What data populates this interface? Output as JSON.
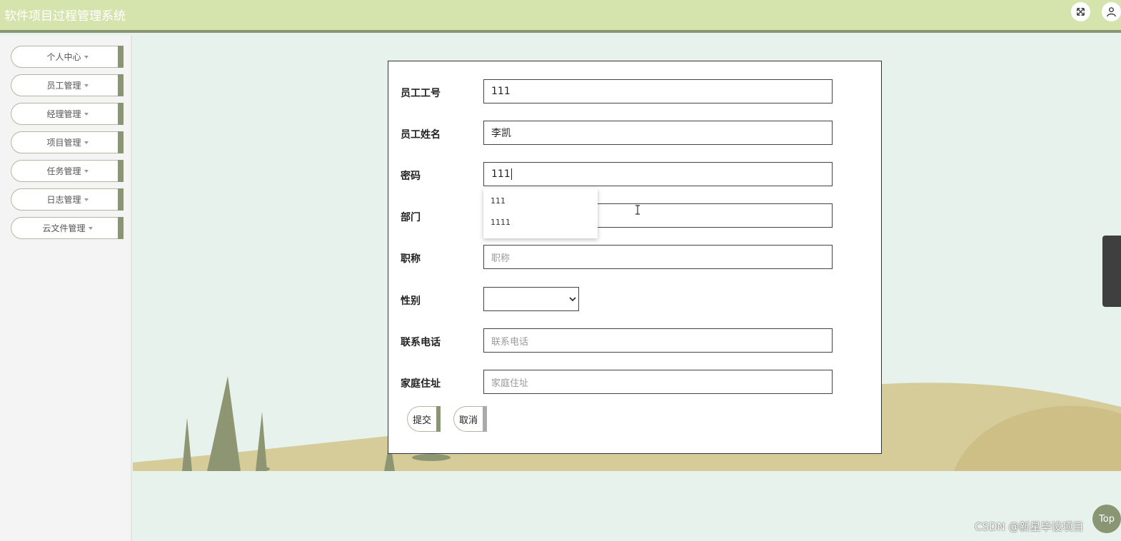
{
  "header": {
    "title": "软件项目过程管理系统",
    "fullscreen_icon": "fullscreen-icon",
    "user_icon": "user-icon",
    "bg_color": "#d5e4ad",
    "accent_color": "#8a9574"
  },
  "sidebar": {
    "items": [
      {
        "label": "个人中心"
      },
      {
        "label": "员工管理"
      },
      {
        "label": "经理管理"
      },
      {
        "label": "项目管理"
      },
      {
        "label": "任务管理"
      },
      {
        "label": "日志管理"
      },
      {
        "label": "云文件管理"
      }
    ]
  },
  "form": {
    "fields": {
      "employee_id": {
        "label": "员工工号",
        "value": "111"
      },
      "employee_name": {
        "label": "员工姓名",
        "value": "李凯"
      },
      "password": {
        "label": "密码",
        "value": "111"
      },
      "department": {
        "label": "部门",
        "value": ""
      },
      "title": {
        "label": "职称",
        "placeholder": "职称"
      },
      "gender": {
        "label": "性别",
        "value": ""
      },
      "phone": {
        "label": "联系电话",
        "placeholder": "联系电话"
      },
      "address": {
        "label": "家庭住址",
        "placeholder": "家庭住址"
      }
    },
    "submit_label": "提交",
    "cancel_label": "取消"
  },
  "autocomplete": {
    "options": [
      "111",
      "1111"
    ]
  },
  "top_button": {
    "label": "Top"
  },
  "watermark": "CSDN @新星毕设项目"
}
